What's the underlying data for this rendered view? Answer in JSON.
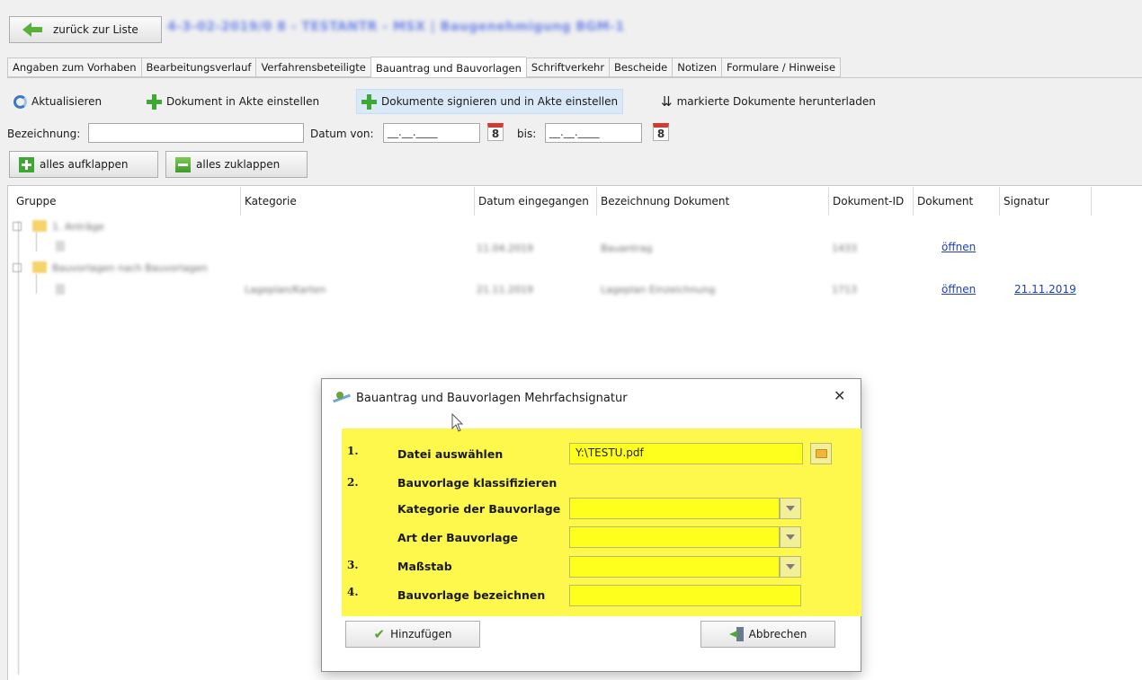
{
  "header": {
    "back_label": "zurück zur Liste",
    "project_title": "4-3-02-2019/0 8 - TESTANTR - MSX | Baugenehmigung BGM-1"
  },
  "tabs": [
    {
      "label": "Angaben zum Vorhaben"
    },
    {
      "label": "Bearbeitungsverlauf"
    },
    {
      "label": "Verfahrensbeteiligte"
    },
    {
      "label": "Bauantrag und Bauvorlagen",
      "active": true
    },
    {
      "label": "Schriftverkehr"
    },
    {
      "label": "Bescheide"
    },
    {
      "label": "Notizen"
    },
    {
      "label": "Formulare / Hinweise"
    }
  ],
  "toolbar": {
    "refresh": "Aktualisieren",
    "add_document": "Dokument in Akte einstellen",
    "sign_documents": "Dokumente signieren und in Akte einstellen",
    "download_marked": "markierte Dokumente herunterladen"
  },
  "filter": {
    "bezeichnung_label": "Bezeichnung:",
    "bezeichnung_value": "",
    "datum_von_label": "Datum von:",
    "datum_von_value": "__.__.____",
    "bis_label": "bis:",
    "bis_value": "__.__.____",
    "calendar_digit": "8"
  },
  "expand": {
    "expand_all": "alles aufklappen",
    "collapse_all": "alles zuklappen"
  },
  "table": {
    "columns": [
      "Gruppe",
      "Kategorie",
      "Datum eingegangen",
      "Bezeichnung Dokument",
      "Dokument-ID",
      "Dokument",
      "Signatur"
    ],
    "groups": [
      {
        "group": "1. Anträge",
        "category": "",
        "date": "11.04.2019",
        "name": "Bauantrag",
        "id": "1433",
        "document": "öffnen",
        "signature": ""
      },
      {
        "group": "Bauvorlagen nach Bauvorlagen",
        "category": "Lageplan/Karten",
        "date": "21.11.2019",
        "name": "Lageplan Einzeichnung",
        "id": "1713",
        "document": "öffnen",
        "signature": "21.11.2019"
      }
    ]
  },
  "dialog": {
    "title": "Bauantrag und Bauvorlagen Mehrfachsignatur",
    "close_glyph": "✕",
    "steps": {
      "n1": "1.",
      "n2": "2.",
      "n3": "3.",
      "n4": "4."
    },
    "fields": {
      "file_label": "Datei auswählen",
      "file_value": "Y:\\TESTU.pdf",
      "classify_label": "Bauvorlage klassifizieren",
      "category_label": "Kategorie der Bauvorlage",
      "category_value": "",
      "type_label": "Art der Bauvorlage",
      "type_value": "",
      "scale_label": "Maßstab",
      "scale_value": "",
      "name_label": "Bauvorlage bezeichnen",
      "name_value": ""
    },
    "add_button": "Hinzufügen",
    "cancel_button": "Abbrechen",
    "colors": {
      "highlight": "#fff84c",
      "field": "#ffff1e"
    }
  }
}
